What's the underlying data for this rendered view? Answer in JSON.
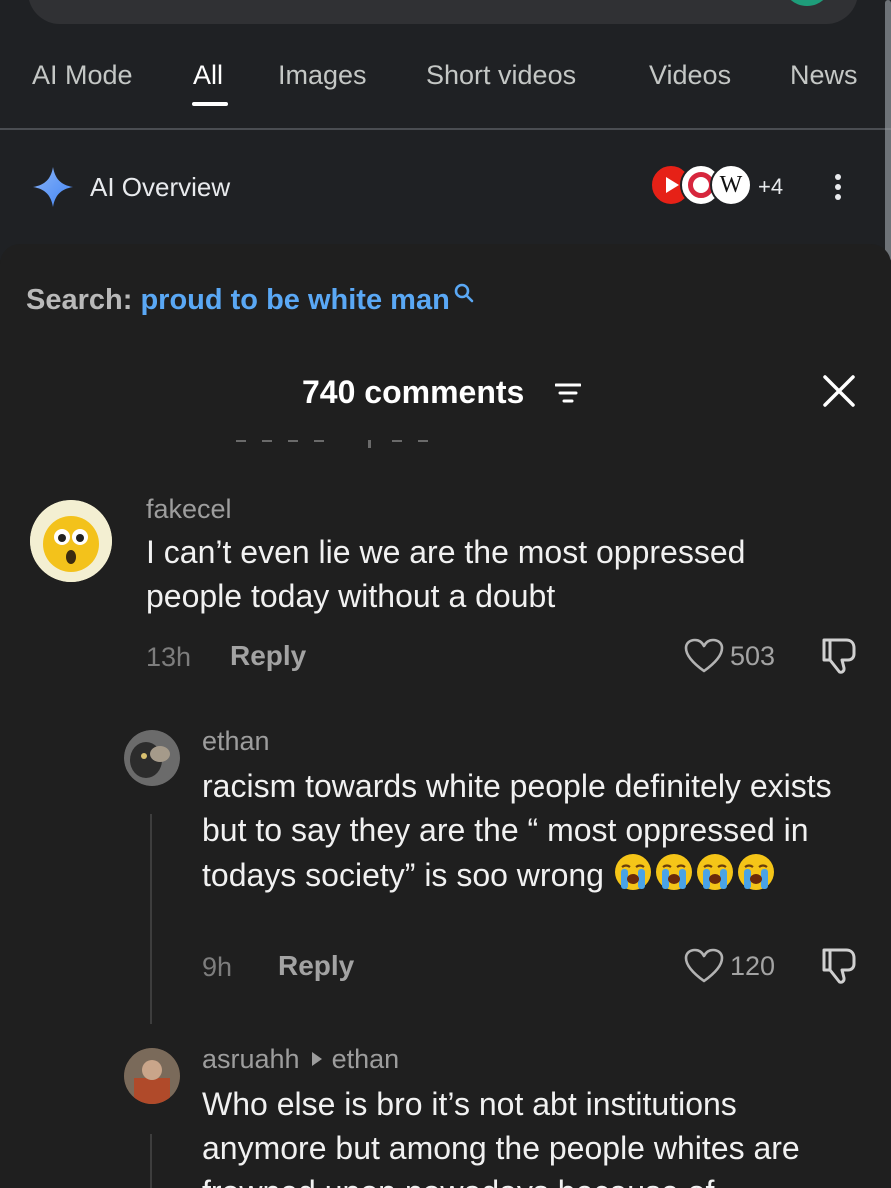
{
  "google": {
    "tabs": [
      {
        "label": "AI Mode"
      },
      {
        "label": "All",
        "active": true
      },
      {
        "label": "Images"
      },
      {
        "label": "Short videos"
      },
      {
        "label": "Videos"
      },
      {
        "label": "News"
      }
    ],
    "ai_overview": {
      "title": "AI Overview",
      "more_sources": "+4",
      "source_icons": [
        "youtube-icon",
        "opera-icon",
        "wikipedia-icon"
      ]
    }
  },
  "sheet": {
    "search_label": "Search:",
    "search_query": "proud to be white man",
    "comments_count": "740 comments",
    "icons": {
      "sort": "sort-icon",
      "close": "close-icon"
    }
  },
  "comments": [
    {
      "username": "fakecel",
      "text": "I can’t even lie we are the most oppressed people today without a doubt",
      "time": "13h",
      "reply_label": "Reply",
      "likes": "503"
    },
    {
      "username": "ethan",
      "text": "racism towards white people definitely exists but to say they are the “ most oppressed in todays society” is soo wrong",
      "emoji_count": 4,
      "emoji": "loudly-crying-face",
      "time": "9h",
      "reply_label": "Reply",
      "likes": "120"
    },
    {
      "username": "asruahh",
      "reply_to": "ethan",
      "text": "Who else is bro it’s not abt institutions anymore but among the people whites are frowned upon nowadays because of"
    }
  ],
  "colors": {
    "background": "#1f1f1f",
    "header_background": "#1f2124",
    "query_link": "#5aa8f5",
    "accent_green": "#1e9d7a"
  }
}
